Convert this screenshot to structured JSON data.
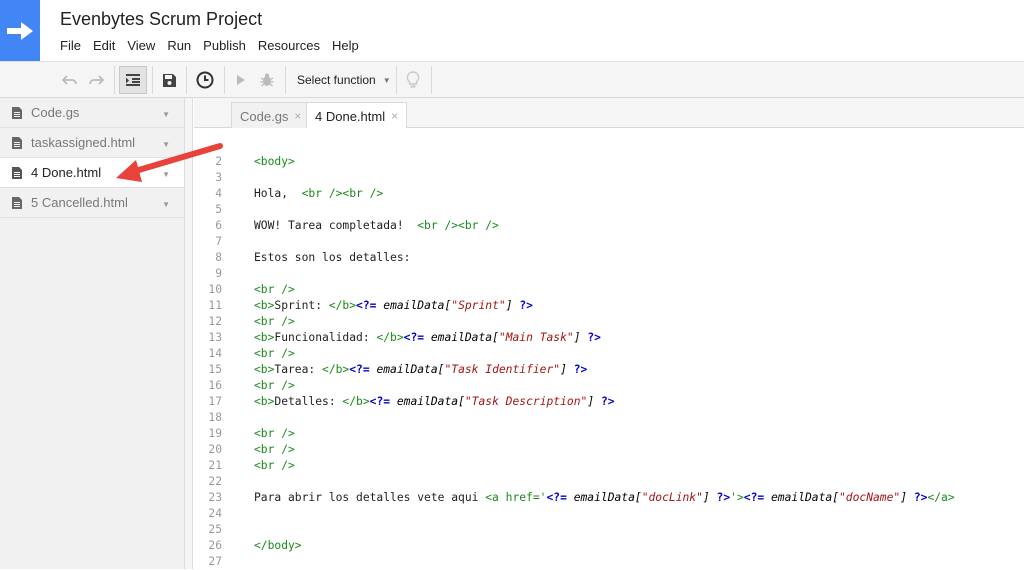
{
  "app": {
    "title": "Evenbytes Scrum Project",
    "menu": [
      "File",
      "Edit",
      "View",
      "Run",
      "Publish",
      "Resources",
      "Help"
    ]
  },
  "toolbar": {
    "select_function_label": "Select function"
  },
  "sidebar": {
    "files": [
      {
        "name": "Code.gs",
        "active": false
      },
      {
        "name": "taskassigned.html",
        "active": false
      },
      {
        "name": "4 Done.html",
        "active": true
      },
      {
        "name": "5 Cancelled.html",
        "active": false
      }
    ]
  },
  "tabs": [
    {
      "label": "Code.gs",
      "close": "×"
    },
    {
      "label": "4 Done.html",
      "close": "×"
    }
  ],
  "editor": {
    "line_numbers": [
      "2",
      "3",
      "4",
      "5",
      "6",
      "7",
      "8",
      "9",
      "10",
      "11",
      "12",
      "13",
      "14",
      "15",
      "16",
      "17",
      "18",
      "19",
      "20",
      "21",
      "22",
      "23",
      "24",
      "25",
      "26",
      "27"
    ],
    "lines": [
      [
        {
          "c": "t-tag",
          "t": "<body>"
        }
      ],
      [],
      [
        {
          "c": "t-text",
          "t": "Hola,  "
        },
        {
          "c": "t-tag",
          "t": "<br /><br />"
        }
      ],
      [],
      [
        {
          "c": "t-text",
          "t": "WOW! Tarea completada!  "
        },
        {
          "c": "t-tag",
          "t": "<br /><br />"
        }
      ],
      [],
      [
        {
          "c": "t-text",
          "t": "Estos son los detalles:"
        }
      ],
      [],
      [
        {
          "c": "t-tag",
          "t": "<br />"
        }
      ],
      [
        {
          "c": "t-tag",
          "t": "<b>"
        },
        {
          "c": "t-text",
          "t": "Sprint: "
        },
        {
          "c": "t-tag",
          "t": "</b>"
        },
        {
          "c": "t-php",
          "t": "<?="
        },
        {
          "c": "t-text",
          "t": " "
        },
        {
          "c": "t-var",
          "t": "emailData["
        },
        {
          "c": "t-str",
          "t": "\"Sprint\""
        },
        {
          "c": "t-var",
          "t": "]"
        },
        {
          "c": "t-text",
          "t": " "
        },
        {
          "c": "t-php",
          "t": "?>"
        }
      ],
      [
        {
          "c": "t-tag",
          "t": "<br />"
        }
      ],
      [
        {
          "c": "t-tag",
          "t": "<b>"
        },
        {
          "c": "t-text",
          "t": "Funcionalidad: "
        },
        {
          "c": "t-tag",
          "t": "</b>"
        },
        {
          "c": "t-php",
          "t": "<?="
        },
        {
          "c": "t-text",
          "t": " "
        },
        {
          "c": "t-var",
          "t": "emailData["
        },
        {
          "c": "t-str",
          "t": "\"Main Task\""
        },
        {
          "c": "t-var",
          "t": "]"
        },
        {
          "c": "t-text",
          "t": " "
        },
        {
          "c": "t-php",
          "t": "?>"
        }
      ],
      [
        {
          "c": "t-tag",
          "t": "<br />"
        }
      ],
      [
        {
          "c": "t-tag",
          "t": "<b>"
        },
        {
          "c": "t-text",
          "t": "Tarea: "
        },
        {
          "c": "t-tag",
          "t": "</b>"
        },
        {
          "c": "t-php",
          "t": "<?="
        },
        {
          "c": "t-text",
          "t": " "
        },
        {
          "c": "t-var",
          "t": "emailData["
        },
        {
          "c": "t-str",
          "t": "\"Task Identifier\""
        },
        {
          "c": "t-var",
          "t": "]"
        },
        {
          "c": "t-text",
          "t": " "
        },
        {
          "c": "t-php",
          "t": "?>"
        }
      ],
      [
        {
          "c": "t-tag",
          "t": "<br />"
        }
      ],
      [
        {
          "c": "t-tag",
          "t": "<b>"
        },
        {
          "c": "t-text",
          "t": "Detalles: "
        },
        {
          "c": "t-tag",
          "t": "</b>"
        },
        {
          "c": "t-php",
          "t": "<?="
        },
        {
          "c": "t-text",
          "t": " "
        },
        {
          "c": "t-var",
          "t": "emailData["
        },
        {
          "c": "t-str",
          "t": "\"Task Description\""
        },
        {
          "c": "t-var",
          "t": "]"
        },
        {
          "c": "t-text",
          "t": " "
        },
        {
          "c": "t-php",
          "t": "?>"
        }
      ],
      [],
      [
        {
          "c": "t-tag",
          "t": "<br />"
        }
      ],
      [
        {
          "c": "t-tag",
          "t": "<br />"
        }
      ],
      [
        {
          "c": "t-tag",
          "t": "<br />"
        }
      ],
      [],
      [
        {
          "c": "t-text",
          "t": "Para abrir los detalles vete aqui "
        },
        {
          "c": "t-tag",
          "t": "<a href='"
        },
        {
          "c": "t-php",
          "t": "<?="
        },
        {
          "c": "t-text",
          "t": " "
        },
        {
          "c": "t-var",
          "t": "emailData["
        },
        {
          "c": "t-str",
          "t": "\"docLink\""
        },
        {
          "c": "t-var",
          "t": "]"
        },
        {
          "c": "t-text",
          "t": " "
        },
        {
          "c": "t-php",
          "t": "?>"
        },
        {
          "c": "t-tag",
          "t": "'>"
        },
        {
          "c": "t-php",
          "t": "<?="
        },
        {
          "c": "t-text",
          "t": " "
        },
        {
          "c": "t-var",
          "t": "emailData["
        },
        {
          "c": "t-str",
          "t": "\"docName\""
        },
        {
          "c": "t-var",
          "t": "]"
        },
        {
          "c": "t-text",
          "t": " "
        },
        {
          "c": "t-php",
          "t": "?>"
        },
        {
          "c": "t-tag",
          "t": "</a>"
        }
      ],
      [],
      [],
      [
        {
          "c": "t-tag",
          "t": "</body>"
        }
      ],
      []
    ]
  },
  "colors": {
    "brand": "#4285f4",
    "arrow": "#e8423a",
    "tag": "#1a8a1a",
    "php": "#0000cc",
    "string": "#a31515"
  }
}
